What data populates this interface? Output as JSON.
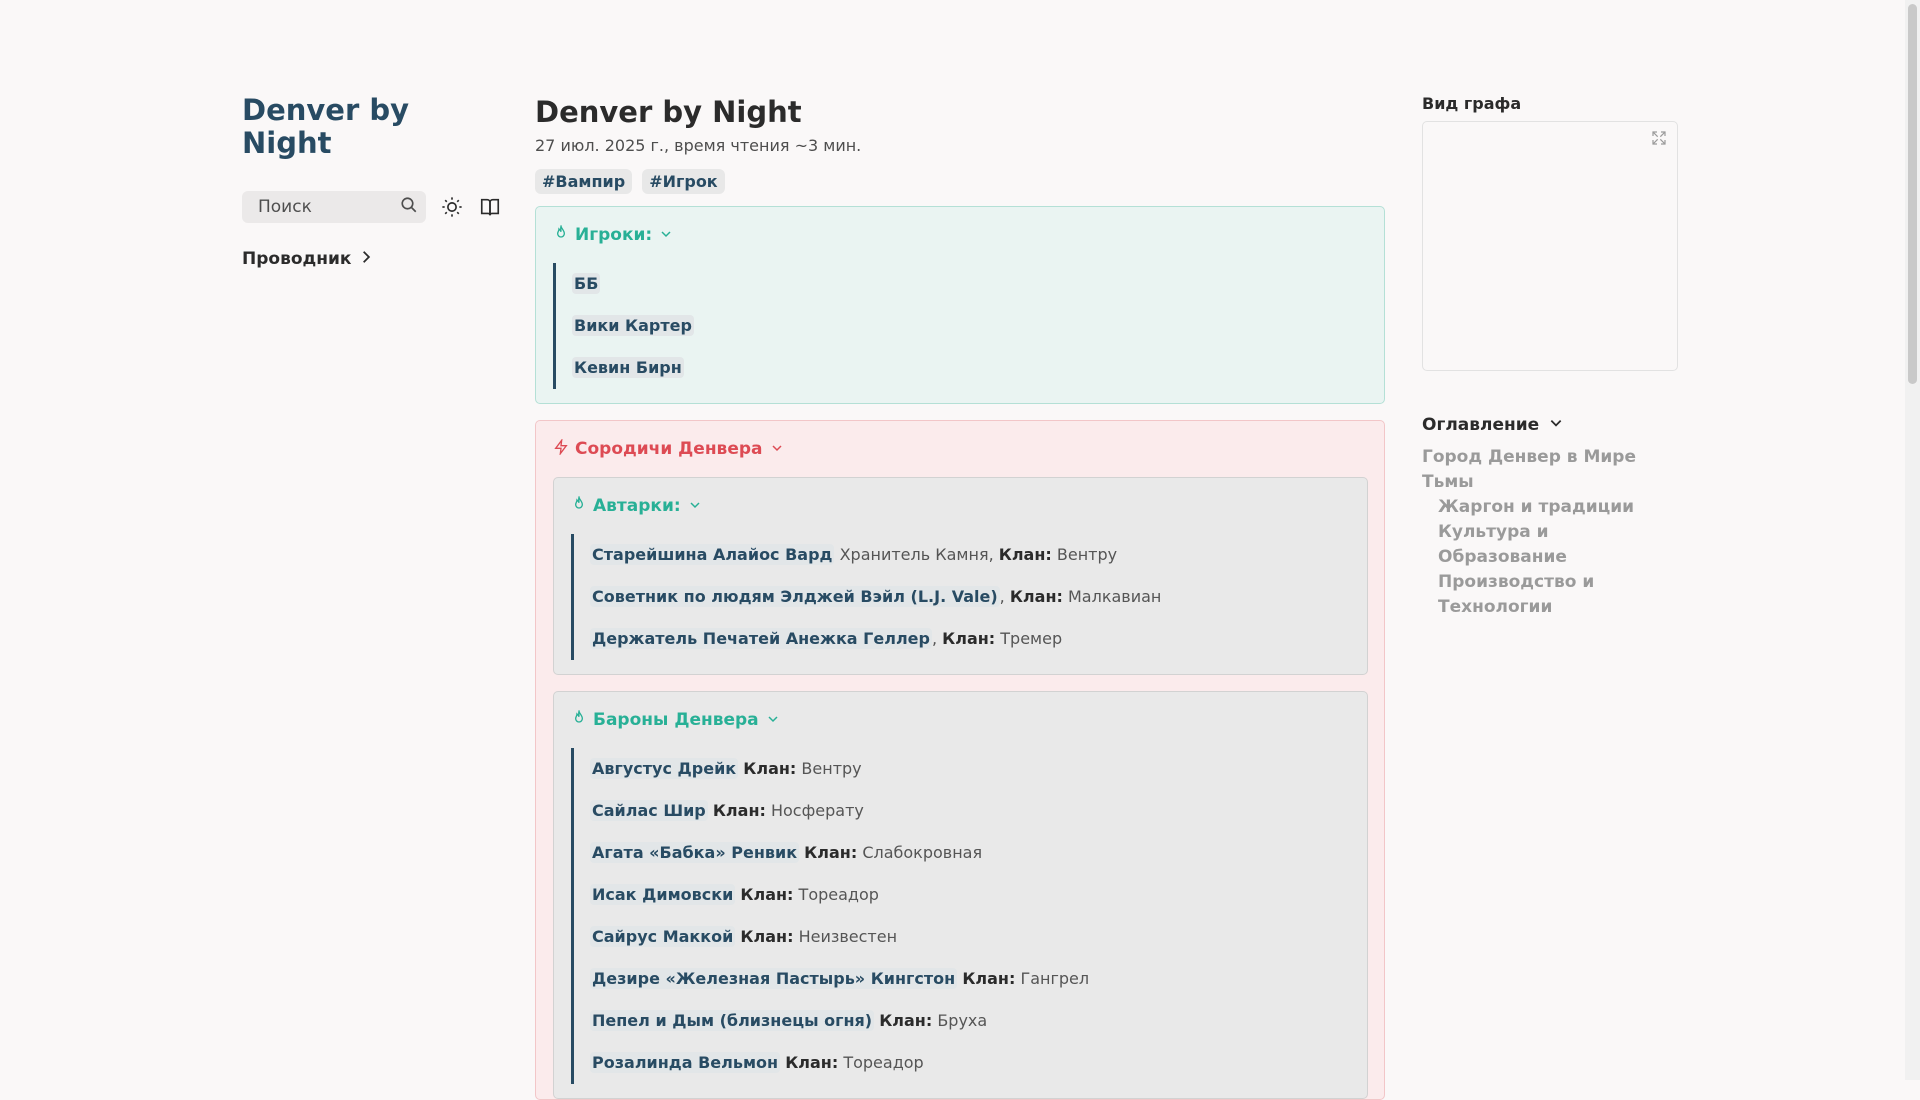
{
  "site": {
    "title": "Denver by Night"
  },
  "search": {
    "placeholder": "Поиск"
  },
  "explorer": {
    "label": "Проводник"
  },
  "page": {
    "title": "Denver by Night",
    "meta": "27 июл. 2025 г., время чтения ~3 мин.",
    "tags": [
      "#Вампир",
      "#Игрок"
    ]
  },
  "players": {
    "title": "Игроки:",
    "items": [
      "ББ",
      "Вики Картер",
      "Кевин Бирн"
    ]
  },
  "kindred": {
    "title": "Сородичи Денвера",
    "clan_label": "Клан:",
    "autarkis": {
      "title": "Автарки:",
      "items": [
        {
          "name": "Старейшина Алайос Вард",
          "before": " Хранитель Камня, ",
          "clan": "Вентру"
        },
        {
          "name": "Советник по людям Элджей Вэйл (L.J. Vale)",
          "before": ", ",
          "clan": "Малкавиан"
        },
        {
          "name": "Держатель Печатей Анежка Геллер",
          "before": ", ",
          "clan": "Тремер"
        }
      ]
    },
    "barons": {
      "title": "Бароны Денвера",
      "items": [
        {
          "name": "Августус Дрейк",
          "before": " ",
          "clan": "Вентру"
        },
        {
          "name": "Сайлас Шир",
          "before": " ",
          "clan": "Носферату"
        },
        {
          "name": "Агата «Бабка» Ренвик",
          "before": " ",
          "clan": "Слабокровная"
        },
        {
          "name": "Исак Димовски",
          "before": " ",
          "clan": "Тореадор"
        },
        {
          "name": "Сайрус Маккой",
          "before": " ",
          "clan": "Неизвестен"
        },
        {
          "name": "Дезире «Железная Пастырь» Кингстон",
          "before": " ",
          "clan": "Гангрел"
        },
        {
          "name": "Пепел и Дым (близнецы огня)",
          "before": " ",
          "clan": "Бруха"
        },
        {
          "name": "Розалинда Вельмон",
          "before": " ",
          "clan": "Тореадор"
        }
      ]
    }
  },
  "graph": {
    "title": "Вид графа"
  },
  "toc": {
    "title": "Оглавление",
    "items": [
      {
        "label": "Город Денвер в Мире Тьмы",
        "level": 1
      },
      {
        "label": "Жаргон и традиции",
        "level": 2
      },
      {
        "label": "Культура и Образование",
        "level": 2
      },
      {
        "label": "Производство и Технологии",
        "level": 2
      }
    ]
  },
  "colors": {
    "accent": "#284b63",
    "teal": "#28b096",
    "red": "#dd4b54"
  },
  "icons": [
    "search-icon",
    "sun-icon",
    "reader-mode-icon",
    "chevron-right-icon",
    "flame-icon",
    "bolt-icon",
    "chevron-down-icon",
    "expand-icon"
  ]
}
